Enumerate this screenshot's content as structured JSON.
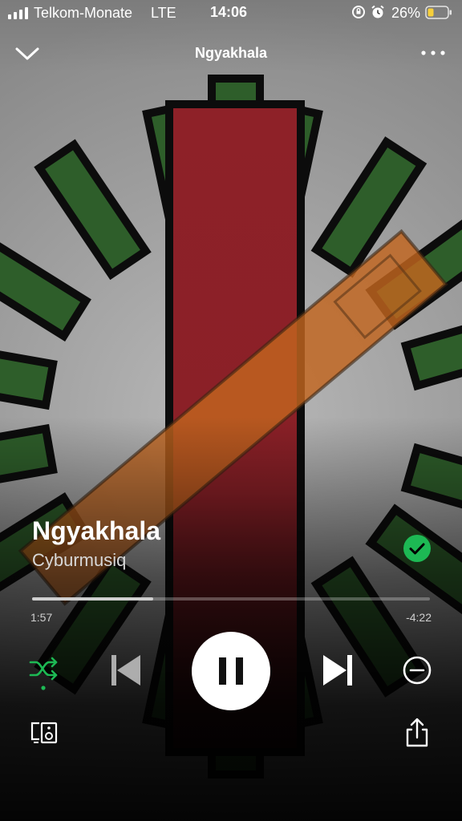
{
  "status_bar": {
    "carrier": "Telkom-Monate",
    "network": "LTE",
    "time": "14:06",
    "battery_percent": "26%",
    "icons": [
      "signal-icon",
      "orientation-lock-icon",
      "alarm-icon",
      "battery-icon"
    ]
  },
  "header": {
    "title": "Ngyakhala",
    "icons": [
      "chevron-down-icon",
      "more-icon"
    ]
  },
  "track": {
    "title": "Ngyakhala",
    "artist": "Cyburmusiq",
    "liked": true
  },
  "playback": {
    "elapsed": "1:57",
    "remaining": "-4:22",
    "progress": 0.305,
    "is_playing": true,
    "shuffle_on": true
  },
  "colors": {
    "accent_green": "#1db954",
    "artwork_green": "#2e5e2a",
    "artwork_red": "#8c2027",
    "artwork_orange": "#c2651e",
    "background_gray": "#9a9a9a",
    "battery_yellow": "#f7cf3a"
  },
  "controls": {
    "icons": [
      "shuffle-icon",
      "previous-icon",
      "pause-icon",
      "next-icon",
      "hide-icon",
      "devices-icon",
      "share-icon"
    ]
  }
}
